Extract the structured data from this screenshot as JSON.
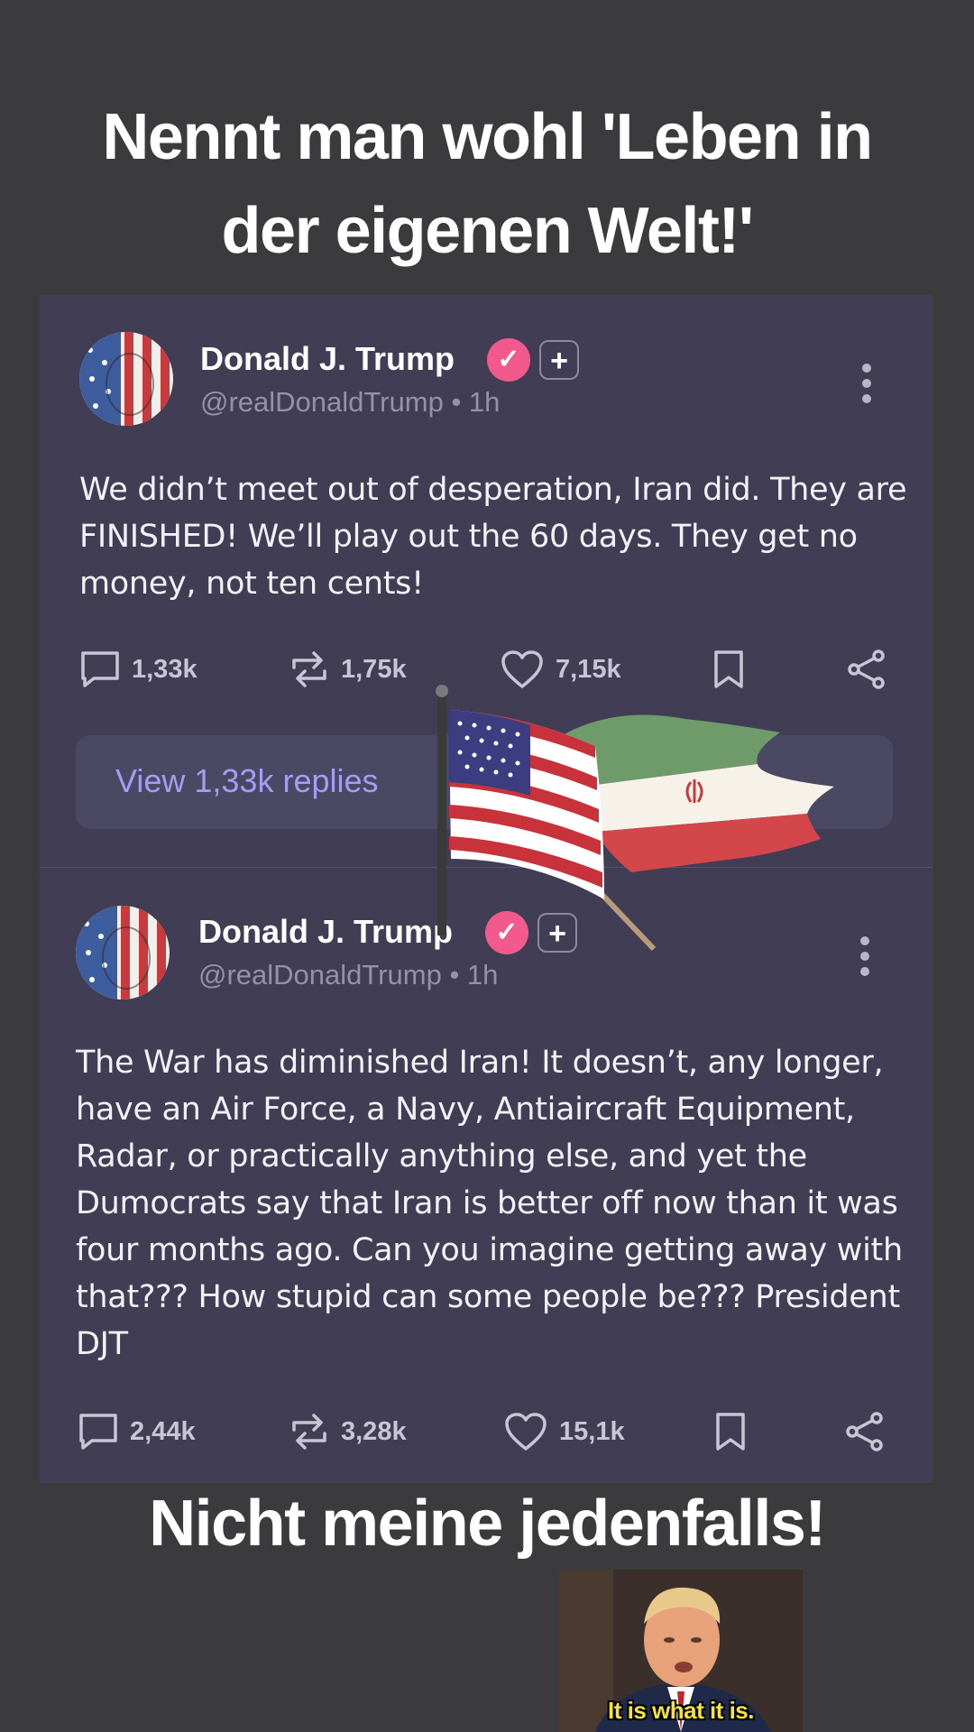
{
  "top_caption": {
    "line1": "Nennt man wohl 'Leben in",
    "line2": "der eigenen Welt!'"
  },
  "bottom_caption": "Nicht meine jedenfalls!",
  "posts": [
    {
      "author": "Donald J. Trump",
      "handle": "@realDonaldTrump",
      "time_sep": "•",
      "time": "1h",
      "text": "We didn’t meet out of desperation, Iran did. They are FINISHED! We’ll play out the 60 days. They get no money, not ten cents!",
      "replies": "1,33k",
      "reposts": "1,75k",
      "likes": "7,15k",
      "view_replies_label": "View 1,33k replies"
    },
    {
      "author": "Donald J. Trump",
      "handle": "@realDonaldTrump",
      "time_sep": "•",
      "time": "1h",
      "text": "The War has diminished Iran! It doesn’t, any longer, have an Air Force, a Navy, Antiaircraft Equipment, Radar, or practically anything else, and yet the Dumocrats say that Iran is better off now than it was four months ago. Can you imagine getting away with that??? How stupid can some people be??? President DJT",
      "replies": "2,44k",
      "reposts": "3,28k",
      "likes": "15,1k"
    }
  ],
  "reaction": {
    "caption": "It is what it is."
  },
  "icons": {
    "verified": "verified-badge-icon",
    "follow": "plus-icon",
    "more": "more-vertical-icon",
    "reply": "comment-icon",
    "repost": "repost-icon",
    "like": "heart-icon",
    "bookmark": "bookmark-icon",
    "share": "share-icon"
  },
  "colors": {
    "background": "#3b3b3d",
    "card": "#403d55",
    "verified": "#f25a8e",
    "link": "#a79cf3",
    "reaction_caption": "#f6e23a"
  }
}
